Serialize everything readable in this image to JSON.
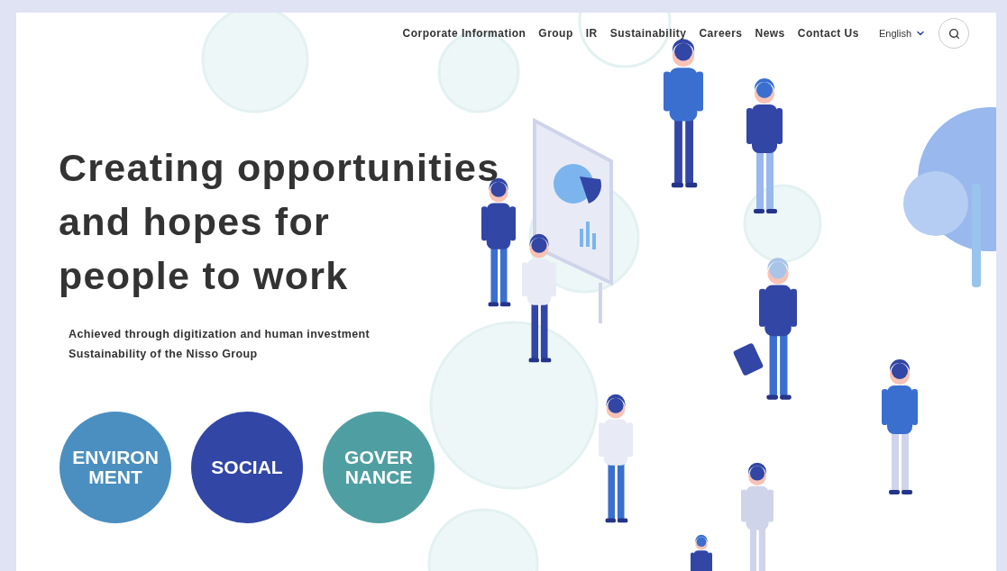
{
  "nav": {
    "items": [
      "Corporate Information",
      "Group",
      "IR",
      "Sustainability",
      "Careers",
      "News",
      "Contact Us"
    ],
    "language": "English"
  },
  "hero": {
    "heading": [
      "Creating opportunities",
      "and hopes for",
      "people to work"
    ],
    "subtitle": [
      "Achieved through digitization and human investment",
      "Sustainability of the Nisso Group"
    ]
  },
  "pillars": [
    {
      "lines": [
        "ENVIRON",
        "MENT"
      ],
      "color": "#4a8fc0"
    },
    {
      "lines": [
        "SOCIAL"
      ],
      "color": "#3146a5"
    },
    {
      "lines": [
        "GOVER",
        "NANCE"
      ],
      "color": "#4f9fa2"
    }
  ]
}
